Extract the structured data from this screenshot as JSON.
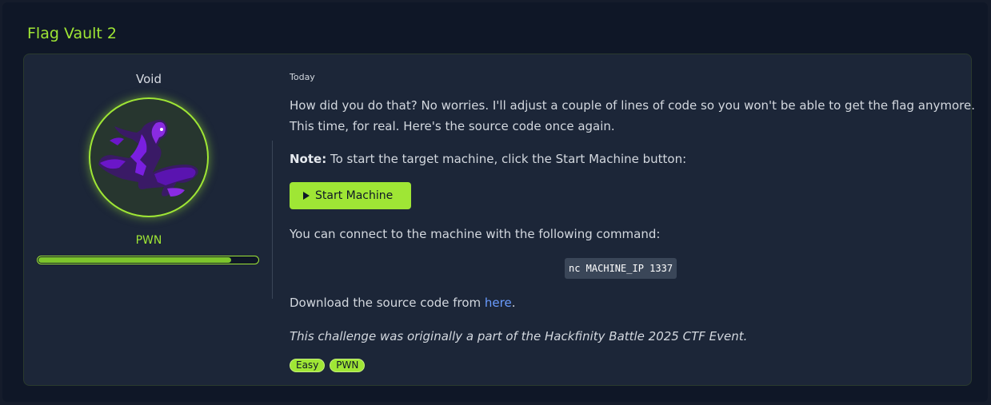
{
  "page": {
    "title": "Flag Vault 2"
  },
  "author": {
    "name": "Void",
    "category": "PWN",
    "progress_percent": 88
  },
  "content": {
    "date": "Today",
    "intro_line1": "How did you do that? No worries. I'll adjust a couple of lines of code so you won't be able to get the flag anymore.",
    "intro_line2": "This time, for real. Here's the source code once again.",
    "note_label": "Note:",
    "note_text": " To start the target machine, click the Start Machine button:",
    "start_button_label": "Start Machine",
    "connect_text": "You can connect to the machine with the following command:",
    "command": "nc MACHINE_IP 1337",
    "download_prefix": "Download the source code from ",
    "download_link": "here",
    "download_suffix": ".",
    "credit": "This challenge was originally a part of the Hackfinity Battle 2025 CTF Event.",
    "tags": [
      "Easy",
      "PWN"
    ]
  },
  "colors": {
    "accent": "#9fe635",
    "background": "#0f1727",
    "card": "#1c2638",
    "link": "#6a9cff"
  }
}
